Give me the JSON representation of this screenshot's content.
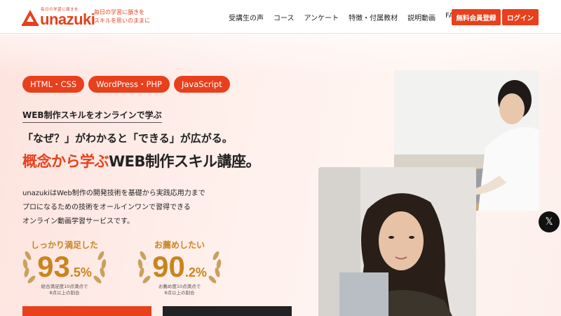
{
  "header": {
    "logo_sub": "毎日の学習に頷きを",
    "logo_name": "unazuki",
    "tagline_line1": "毎日の学習に頷きを",
    "tagline_line2": "スキルを思いのままに",
    "nav": [
      "受講生の声",
      "コース",
      "アンケート",
      "特徴・付属教材",
      "説明動画",
      "FAQ"
    ],
    "register_label": "無料会員登録",
    "login_label": "ログイン"
  },
  "hero": {
    "tags": [
      "HTML・CSS",
      "WordPress・PHP",
      "JavaScript"
    ],
    "sub_heading": "WEB制作スキルをオンラインで学ぶ",
    "headline1": "「なぜ？」がわかると「できる」が広がる。",
    "headline2_accent": "概念から学ぶ",
    "headline2_rest": "WEB制作スキル講座。",
    "desc_line1": "unazukiはWeb制作の開発技術を基礎から実践応用力まで",
    "desc_line2": "プロになるための技術をオールインワンで習得できる",
    "desc_line3": "オンライン動画学習サービスです。"
  },
  "stats": [
    {
      "label": "しっかり満足した",
      "big": "93",
      "small": ".5",
      "unit": "%",
      "note1": "総合満足度10点満点で",
      "note2": "8点以上の割合",
      "value_percent": 93.5
    },
    {
      "label": "お薦めしたい",
      "big": "90",
      "small": ".2",
      "unit": "%",
      "note1": "お薦め度10点満点で",
      "note2": "8点以上の割合",
      "value_percent": 90.2
    }
  ],
  "social": {
    "x_label": "𝕏"
  },
  "colors": {
    "accent": "#e8401c",
    "gold": "#c8851e",
    "dark": "#222222"
  },
  "icons": {
    "logo": "logo-mark-icon",
    "laurel": "laurel-icon",
    "x": "x-icon"
  }
}
